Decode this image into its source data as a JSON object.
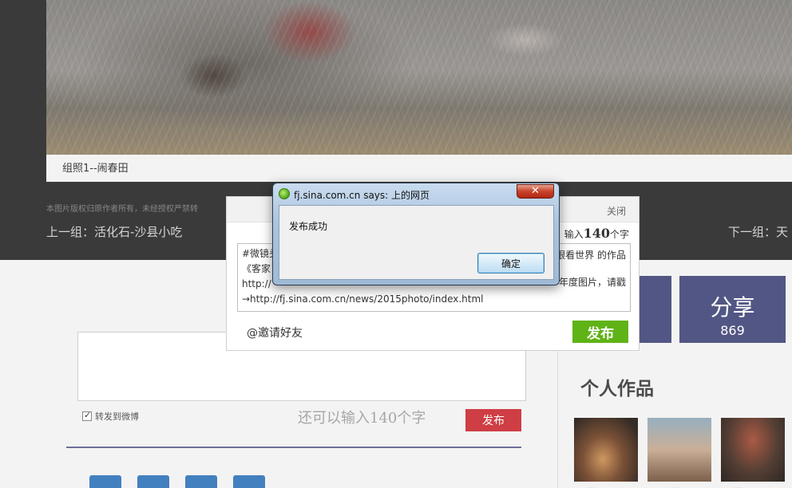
{
  "gallery": {
    "caption": "组照1--闹春田",
    "copyright": "本图片版权归原作者所有，未经授权严禁转",
    "prev_group": "上一组：活化石-沙县小吃",
    "next_group": "下一组：天"
  },
  "comment": {
    "forward_label": "转发到微博",
    "char_count": "还可以输入140个字",
    "publish_label": "发布"
  },
  "right_column": {
    "share_label": "分享",
    "share_count": "869",
    "section_title": "个人作品",
    "thumb_captions": [
      "...",
      "...",
      "..."
    ]
  },
  "share_popup": {
    "close_label": "关闭",
    "remaining_prefix": "输入",
    "remaining_number": "140",
    "remaining_suffix": "个字",
    "text_lines": [
      "#微镜头",
      "《客家",
      "http://",
      "→http://fj.sina.com.cn/news/2015photo/index.html"
    ],
    "right_fragment_1": "眼看世界 的作品",
    "right_fragment_2": "年度图片，请戳",
    "mention_label": "@邀请好友",
    "publish_label": "发布"
  },
  "alert": {
    "title": "fj.sina.com.cn says: 上的网页",
    "close_glyph": "✕",
    "message": "发布成功",
    "ok_label": "确定"
  }
}
